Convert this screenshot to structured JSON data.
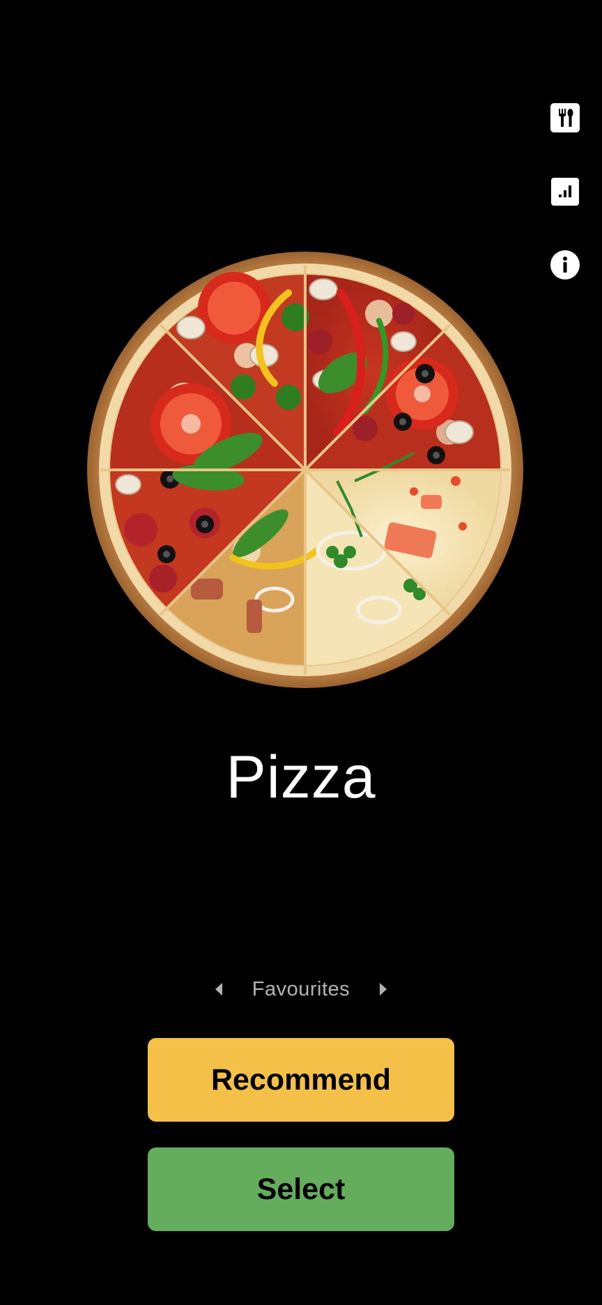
{
  "sidebar": {
    "icons": [
      {
        "name": "restaurant-icon"
      },
      {
        "name": "stats-icon"
      },
      {
        "name": "info-icon"
      }
    ]
  },
  "food": {
    "name": "Pizza"
  },
  "category": {
    "current": "Favourites"
  },
  "actions": {
    "recommend_label": "Recommend",
    "select_label": "Select"
  },
  "colors": {
    "background": "#000000",
    "recommend": "#f4c048",
    "select": "#63ad5c",
    "category_text": "#b3b3b3"
  }
}
